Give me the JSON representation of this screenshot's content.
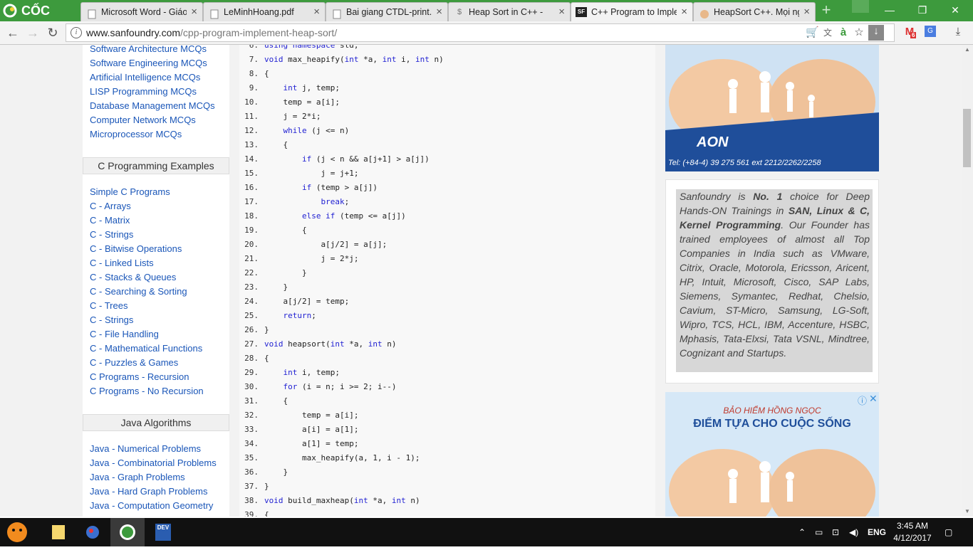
{
  "browser": {
    "brand": "CỐC CỐC",
    "tabs": [
      {
        "title": "Microsoft Word - Giáo",
        "icon": "document-icon"
      },
      {
        "title": "LeMinhHoang.pdf",
        "icon": "document-icon"
      },
      {
        "title": "Bai giang CTDL-print.d",
        "icon": "document-icon"
      },
      {
        "title": "Heap Sort in C++ -",
        "icon": "dollar-icon"
      },
      {
        "title": "C++ Program to Imple",
        "icon": "sf-icon"
      },
      {
        "title": "HeapSort C++. Mọi ng",
        "icon": "face-icon"
      }
    ],
    "active_tab": 4,
    "url_host": "www.sanfoundry.com",
    "url_path": "/cpp-program-implement-heap-sort/",
    "mail_badge": "6",
    "accent": "#3d9a3d"
  },
  "sidebar": {
    "top_links": [
      "Software Architecture MCQs",
      "Software Engineering MCQs",
      "Artificial Intelligence MCQs",
      "LISP Programming MCQs",
      "Database Management MCQs",
      "Computer Network MCQs",
      "Microprocessor MCQs"
    ],
    "c_heading": "C Programming Examples",
    "c_links": [
      "Simple C Programs",
      "C - Arrays",
      "C - Matrix",
      "C - Strings",
      "C - Bitwise Operations",
      "C - Linked Lists",
      "C - Stacks & Queues",
      "C - Searching & Sorting",
      "C - Trees",
      "C - Strings",
      "C - File Handling",
      "C - Mathematical Functions",
      "C - Puzzles & Games",
      "C Programs - Recursion",
      "C Programs - No Recursion"
    ],
    "java_heading": "Java Algorithms",
    "java_links": [
      "Java - Numerical Problems",
      "Java - Combinatorial Problems",
      "Java - Graph Problems",
      "Java - Hard Graph Problems",
      "Java - Computation Geometry"
    ]
  },
  "code": {
    "lines": [
      {
        "n": "6.",
        "code": "using namespace std;"
      },
      {
        "n": "7.",
        "code": "void max_heapify(int *a, int i, int n)"
      },
      {
        "n": "8.",
        "code": "{"
      },
      {
        "n": "9.",
        "code": "    int j, temp;"
      },
      {
        "n": "10.",
        "code": "    temp = a[i];"
      },
      {
        "n": "11.",
        "code": "    j = 2*i;"
      },
      {
        "n": "12.",
        "code": "    while (j <= n)"
      },
      {
        "n": "13.",
        "code": "    {"
      },
      {
        "n": "14.",
        "code": "        if (j < n && a[j+1] > a[j])"
      },
      {
        "n": "15.",
        "code": "            j = j+1;"
      },
      {
        "n": "16.",
        "code": "        if (temp > a[j])"
      },
      {
        "n": "17.",
        "code": "            break;"
      },
      {
        "n": "18.",
        "code": "        else if (temp <= a[j])"
      },
      {
        "n": "19.",
        "code": "        {"
      },
      {
        "n": "20.",
        "code": "            a[j/2] = a[j];"
      },
      {
        "n": "21.",
        "code": "            j = 2*j;"
      },
      {
        "n": "22.",
        "code": "        }"
      },
      {
        "n": "23.",
        "code": "    }"
      },
      {
        "n": "24.",
        "code": "    a[j/2] = temp;"
      },
      {
        "n": "25.",
        "code": "    return;"
      },
      {
        "n": "26.",
        "code": "}"
      },
      {
        "n": "27.",
        "code": "void heapsort(int *a, int n)"
      },
      {
        "n": "28.",
        "code": "{"
      },
      {
        "n": "29.",
        "code": "    int i, temp;"
      },
      {
        "n": "30.",
        "code": "    for (i = n; i >= 2; i--)"
      },
      {
        "n": "31.",
        "code": "    {"
      },
      {
        "n": "32.",
        "code": "        temp = a[i];"
      },
      {
        "n": "33.",
        "code": "        a[i] = a[1];"
      },
      {
        "n": "34.",
        "code": "        a[1] = temp;"
      },
      {
        "n": "35.",
        "code": "        max_heapify(a, 1, i - 1);"
      },
      {
        "n": "36.",
        "code": "    }"
      },
      {
        "n": "37.",
        "code": "}"
      },
      {
        "n": "38.",
        "code": "void build_maxheap(int *a, int n)"
      },
      {
        "n": "39.",
        "code": "{"
      }
    ]
  },
  "ads": {
    "top_phone": "Tel: (+84-4) 39 275 561 ext 2212/2262/2258",
    "top_brand": "AON",
    "bottom_line1": "BẢO HIỂM HỒNG NGỌC",
    "bottom_line2": "ĐIỂM TỰA CHO CUỘC SỐNG"
  },
  "about": {
    "p1": "Sanfoundry is ",
    "b1": "No. 1",
    "p2": " choice for Deep Hands-ON Trainings in ",
    "b2": "SAN, Linux & C, Kernel Programming",
    "p3": ". Our Founder has trained employees of almost all Top Companies in India such as VMware, Citrix, Oracle, Motorola, Ericsson, Aricent, HP, Intuit, Microsoft, Cisco, SAP Labs, Siemens, Symantec, Redhat, Chelsio, Cavium, ST-Micro, Samsung, LG-Soft, Wipro, TCS, HCL, IBM, Accenture, HSBC, Mphasis, Tata-Elxsi, Tata VSNL, Mindtree, Cognizant and Startups."
  },
  "taskbar": {
    "lang": "ENG",
    "time": "3:45 AM",
    "date": "4/12/2017",
    "dev_label": "DEV"
  }
}
